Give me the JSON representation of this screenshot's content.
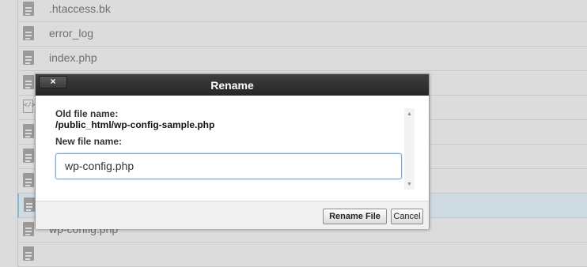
{
  "file_list": {
    "rows": [
      {
        "name": ".htaccess.bk",
        "icon": "document-icon",
        "selected": false
      },
      {
        "name": "error_log",
        "icon": "document-icon",
        "selected": false
      },
      {
        "name": "index.php",
        "icon": "document-icon",
        "selected": false
      },
      {
        "name": "",
        "icon": "document-icon",
        "selected": false
      },
      {
        "name": "",
        "icon": "code-file-icon",
        "selected": false
      },
      {
        "name": "",
        "icon": "document-icon",
        "selected": false
      },
      {
        "name": "",
        "icon": "document-icon",
        "selected": false
      },
      {
        "name": "",
        "icon": "document-icon",
        "selected": false
      },
      {
        "name": "",
        "icon": "document-icon",
        "selected": true
      },
      {
        "name": "wp-config.php",
        "icon": "document-icon",
        "selected": false
      },
      {
        "name": "",
        "icon": "document-icon",
        "selected": false
      }
    ]
  },
  "dialog": {
    "title": "Rename",
    "close_label": "×",
    "old_label": "Old file name:",
    "old_value": "/public_html/wp-config-sample.php",
    "new_label": "New file name:",
    "new_value": "wp-config.php",
    "rename_button": "Rename File",
    "cancel_button": "Cancel"
  },
  "colors": {
    "titlebar": "#2b2b2b",
    "overlay_bg": "#dcdcdc",
    "selected_row": "#cfdbe3"
  }
}
